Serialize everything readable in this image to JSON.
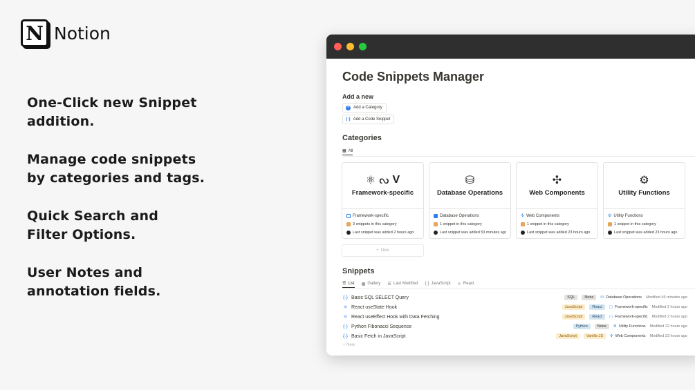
{
  "brand": {
    "logo_letter": "N",
    "name": "Notion"
  },
  "features": [
    "One-Click new Snippet\naddition.",
    "Manage code snippets\nby categories and tags.",
    "Quick Search and\nFilter Options.",
    "User Notes and\nannotation fields."
  ],
  "window": {
    "title": "Code Snippets Manager",
    "add_heading": "Add a new",
    "add_category": "Add a Category",
    "add_snippet": "Add a Code Snippet",
    "categories_heading": "Categories",
    "categories_tab": "All",
    "categories": [
      {
        "title": "Framework-specific",
        "icons": [
          "⚛",
          "ᔓ",
          "V"
        ],
        "name": "Framework-specific",
        "name_icon": "square-outline-icon",
        "count": "3 snippets in this category",
        "last": "Last snippet was added 2 hours ago"
      },
      {
        "title": "Database Operations",
        "icons": [
          "⛁"
        ],
        "name": "Database Operations",
        "name_icon": "database-icon",
        "count": "1 snippet in this category",
        "last": "Last snippet was added 53 minutes ago"
      },
      {
        "title": "Web Components",
        "icons": [
          "✣"
        ],
        "name": "Web Components",
        "name_icon": "puzzle-icon",
        "count": "1 snippet in this category",
        "last": "Last snippet was added 23 hours ago"
      },
      {
        "title": "Utility Functions",
        "icons": [
          "⚙"
        ],
        "name": "Utility Functions",
        "name_icon": "gears-icon",
        "count": "1 snippet in this category",
        "last": "Last snippet was added 23 hours ago"
      }
    ],
    "new_label": "New",
    "snippets_heading": "Snippets",
    "snippet_tabs": [
      "List",
      "Gallery",
      "Last Modified",
      "JavaScript",
      "React"
    ],
    "snippets": [
      {
        "icon": "{·}",
        "name": "Basic SQL SELECT Query",
        "tags": [
          {
            "label": "SQL",
            "bg": "#e3e2e0",
            "fg": "#37352f"
          },
          {
            "label": "None",
            "bg": "#e3e2e0",
            "fg": "#37352f"
          }
        ],
        "category": "Database Operations",
        "cat_icon": "⛁",
        "modified": "Modified 46 minutes ago"
      },
      {
        "icon": "⚛",
        "name": "React useState Hook",
        "tags": [
          {
            "label": "JavaScript",
            "bg": "#fdecc8",
            "fg": "#8a5a16"
          },
          {
            "label": "React",
            "bg": "#d3e5ef",
            "fg": "#28456c"
          }
        ],
        "category": "Framework-specific",
        "cat_icon": "▢",
        "modified": "Modified 2 hours ago"
      },
      {
        "icon": "⚛",
        "name": "React useEffect Hook with Data Fetching",
        "tags": [
          {
            "label": "JavaScript",
            "bg": "#fdecc8",
            "fg": "#8a5a16"
          },
          {
            "label": "React",
            "bg": "#d3e5ef",
            "fg": "#28456c"
          }
        ],
        "category": "Framework-specific",
        "cat_icon": "▢",
        "modified": "Modified 2 hours ago"
      },
      {
        "icon": "{·}",
        "name": "Python Fibonacci Sequence",
        "tags": [
          {
            "label": "Python",
            "bg": "#d3e5ef",
            "fg": "#28456c"
          },
          {
            "label": "None",
            "bg": "#e3e2e0",
            "fg": "#37352f"
          }
        ],
        "category": "Utility Functions",
        "cat_icon": "⚙",
        "modified": "Modified 22 hours ago"
      },
      {
        "icon": "{·}",
        "name": "Basic Fetch in JavaScript",
        "tags": [
          {
            "label": "JavaScript",
            "bg": "#fdecc8",
            "fg": "#8a5a16"
          },
          {
            "label": "Vanilla JS",
            "bg": "#fdecc8",
            "fg": "#8a5a16"
          }
        ],
        "category": "Web Components",
        "cat_icon": "✣",
        "modified": "Modified 23 hours ago"
      }
    ]
  }
}
